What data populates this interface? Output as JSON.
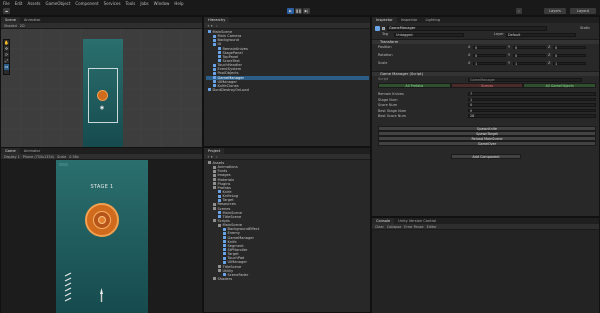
{
  "menu": [
    "File",
    "Edit",
    "Assets",
    "GameObject",
    "Component",
    "Services",
    "Tools",
    "Jobs",
    "Window",
    "Help"
  ],
  "toolbar": {
    "layers": "Layers",
    "layout": "Layout"
  },
  "scene": {
    "tabs": [
      "Scene",
      "Animator"
    ],
    "shading": "Shaded",
    "mode": "2D"
  },
  "game": {
    "tabs": [
      "Game",
      "Animator"
    ],
    "display": "Display 1",
    "resolution": "Phone (750x1334)",
    "scale_label": "Scale",
    "scale": "0.58x",
    "stage_text": "STAGE 1"
  },
  "hierarchy": {
    "tab": "Hierarchy",
    "items": [
      {
        "label": "MainScene",
        "depth": 0
      },
      {
        "label": "Main Camera",
        "depth": 1
      },
      {
        "label": "Background",
        "depth": 1
      },
      {
        "label": "UI",
        "depth": 1
      },
      {
        "label": "RemainKnives",
        "depth": 2
      },
      {
        "label": "StagePanel",
        "depth": 2
      },
      {
        "label": "TopPanel",
        "depth": 2
      },
      {
        "label": "ScoreText",
        "depth": 2
      },
      {
        "label": "TouchHandler",
        "depth": 1
      },
      {
        "label": "EventSystem",
        "depth": 1
      },
      {
        "label": "PoolObjects",
        "depth": 1
      },
      {
        "label": "GameManager",
        "depth": 1,
        "selected": true
      },
      {
        "label": "UIManager",
        "depth": 1
      },
      {
        "label": "KnifeClones",
        "depth": 1
      },
      {
        "label": "DontDestroyOnLoad",
        "depth": 0
      }
    ]
  },
  "project": {
    "tab": "Project",
    "items": [
      {
        "label": "Assets",
        "depth": 0,
        "folder": true
      },
      {
        "label": "Animations",
        "depth": 1,
        "folder": true
      },
      {
        "label": "Fonts",
        "depth": 1,
        "folder": true
      },
      {
        "label": "Images",
        "depth": 1,
        "folder": true
      },
      {
        "label": "Materials",
        "depth": 1,
        "folder": true
      },
      {
        "label": "Plugins",
        "depth": 1,
        "folder": true
      },
      {
        "label": "Prefabs",
        "depth": 1,
        "folder": true
      },
      {
        "label": "Knife",
        "depth": 2
      },
      {
        "label": "KnifeLog",
        "depth": 2
      },
      {
        "label": "Target",
        "depth": 2
      },
      {
        "label": "Resources",
        "depth": 1,
        "folder": true
      },
      {
        "label": "Scenes",
        "depth": 1,
        "folder": true
      },
      {
        "label": "MainScene",
        "depth": 2
      },
      {
        "label": "TitleScene",
        "depth": 2
      },
      {
        "label": "Scripts",
        "depth": 1,
        "folder": true
      },
      {
        "label": "MainScene",
        "depth": 2,
        "folder": true
      },
      {
        "label": "BackgroundEffect",
        "depth": 3
      },
      {
        "label": "Enemy",
        "depth": 3
      },
      {
        "label": "GameManager",
        "depth": 3
      },
      {
        "label": "Knife",
        "depth": 3
      },
      {
        "label": "Segment",
        "depth": 3
      },
      {
        "label": "StPHandler",
        "depth": 3
      },
      {
        "label": "Target",
        "depth": 3
      },
      {
        "label": "TouchPad",
        "depth": 3
      },
      {
        "label": "UIManager",
        "depth": 3
      },
      {
        "label": "TitleScene",
        "depth": 2,
        "folder": true
      },
      {
        "label": "Utility",
        "depth": 2,
        "folder": true
      },
      {
        "label": "SceneFader",
        "depth": 3
      },
      {
        "label": "Shaders",
        "depth": 1,
        "folder": true
      }
    ]
  },
  "inspector": {
    "tabs": [
      "Inspector",
      "Inspector",
      "Lighting"
    ],
    "object_name": "GameManager",
    "static": "Static",
    "tag_label": "Tag",
    "tag_value": "Untagged",
    "layer_label": "Layer",
    "layer_value": "Default",
    "transform": {
      "title": "Transform",
      "rows": [
        {
          "label": "Position",
          "x": "0",
          "y": "0",
          "z": "0"
        },
        {
          "label": "Rotation",
          "x": "0",
          "y": "0",
          "z": "0"
        },
        {
          "label": "Scale",
          "x": "1",
          "y": "1",
          "z": "1"
        }
      ]
    },
    "component": {
      "title": "Game Manager (Script)",
      "script_label": "Script",
      "script_value": "GameManager",
      "tabs": [
        "All Prefabs",
        "Scenes",
        "All GameObjects"
      ],
      "fields": [
        {
          "label": "Remain Knives",
          "value": "7"
        },
        {
          "label": "Stage Num",
          "value": "1"
        },
        {
          "label": "Score Num",
          "value": "0"
        },
        {
          "label": "Best Stage Num",
          "value": "0"
        },
        {
          "label": "Best Score Num",
          "value": "28"
        }
      ],
      "buttons": [
        "SpawnKnife",
        "SpawnTarget",
        "Reload MainScene",
        "GameOver"
      ]
    },
    "add_component": "Add Component"
  },
  "console": {
    "tabs": [
      "Console",
      "Unity Version Control"
    ],
    "controls": [
      "Clear",
      "Collapse",
      "Error Pause",
      "Editor"
    ]
  },
  "colors": {
    "accent": "#2c5d87",
    "game_bg_top": "#2b6f6f",
    "game_bg_bottom": "#164b4e",
    "target": "#d06a1c"
  }
}
